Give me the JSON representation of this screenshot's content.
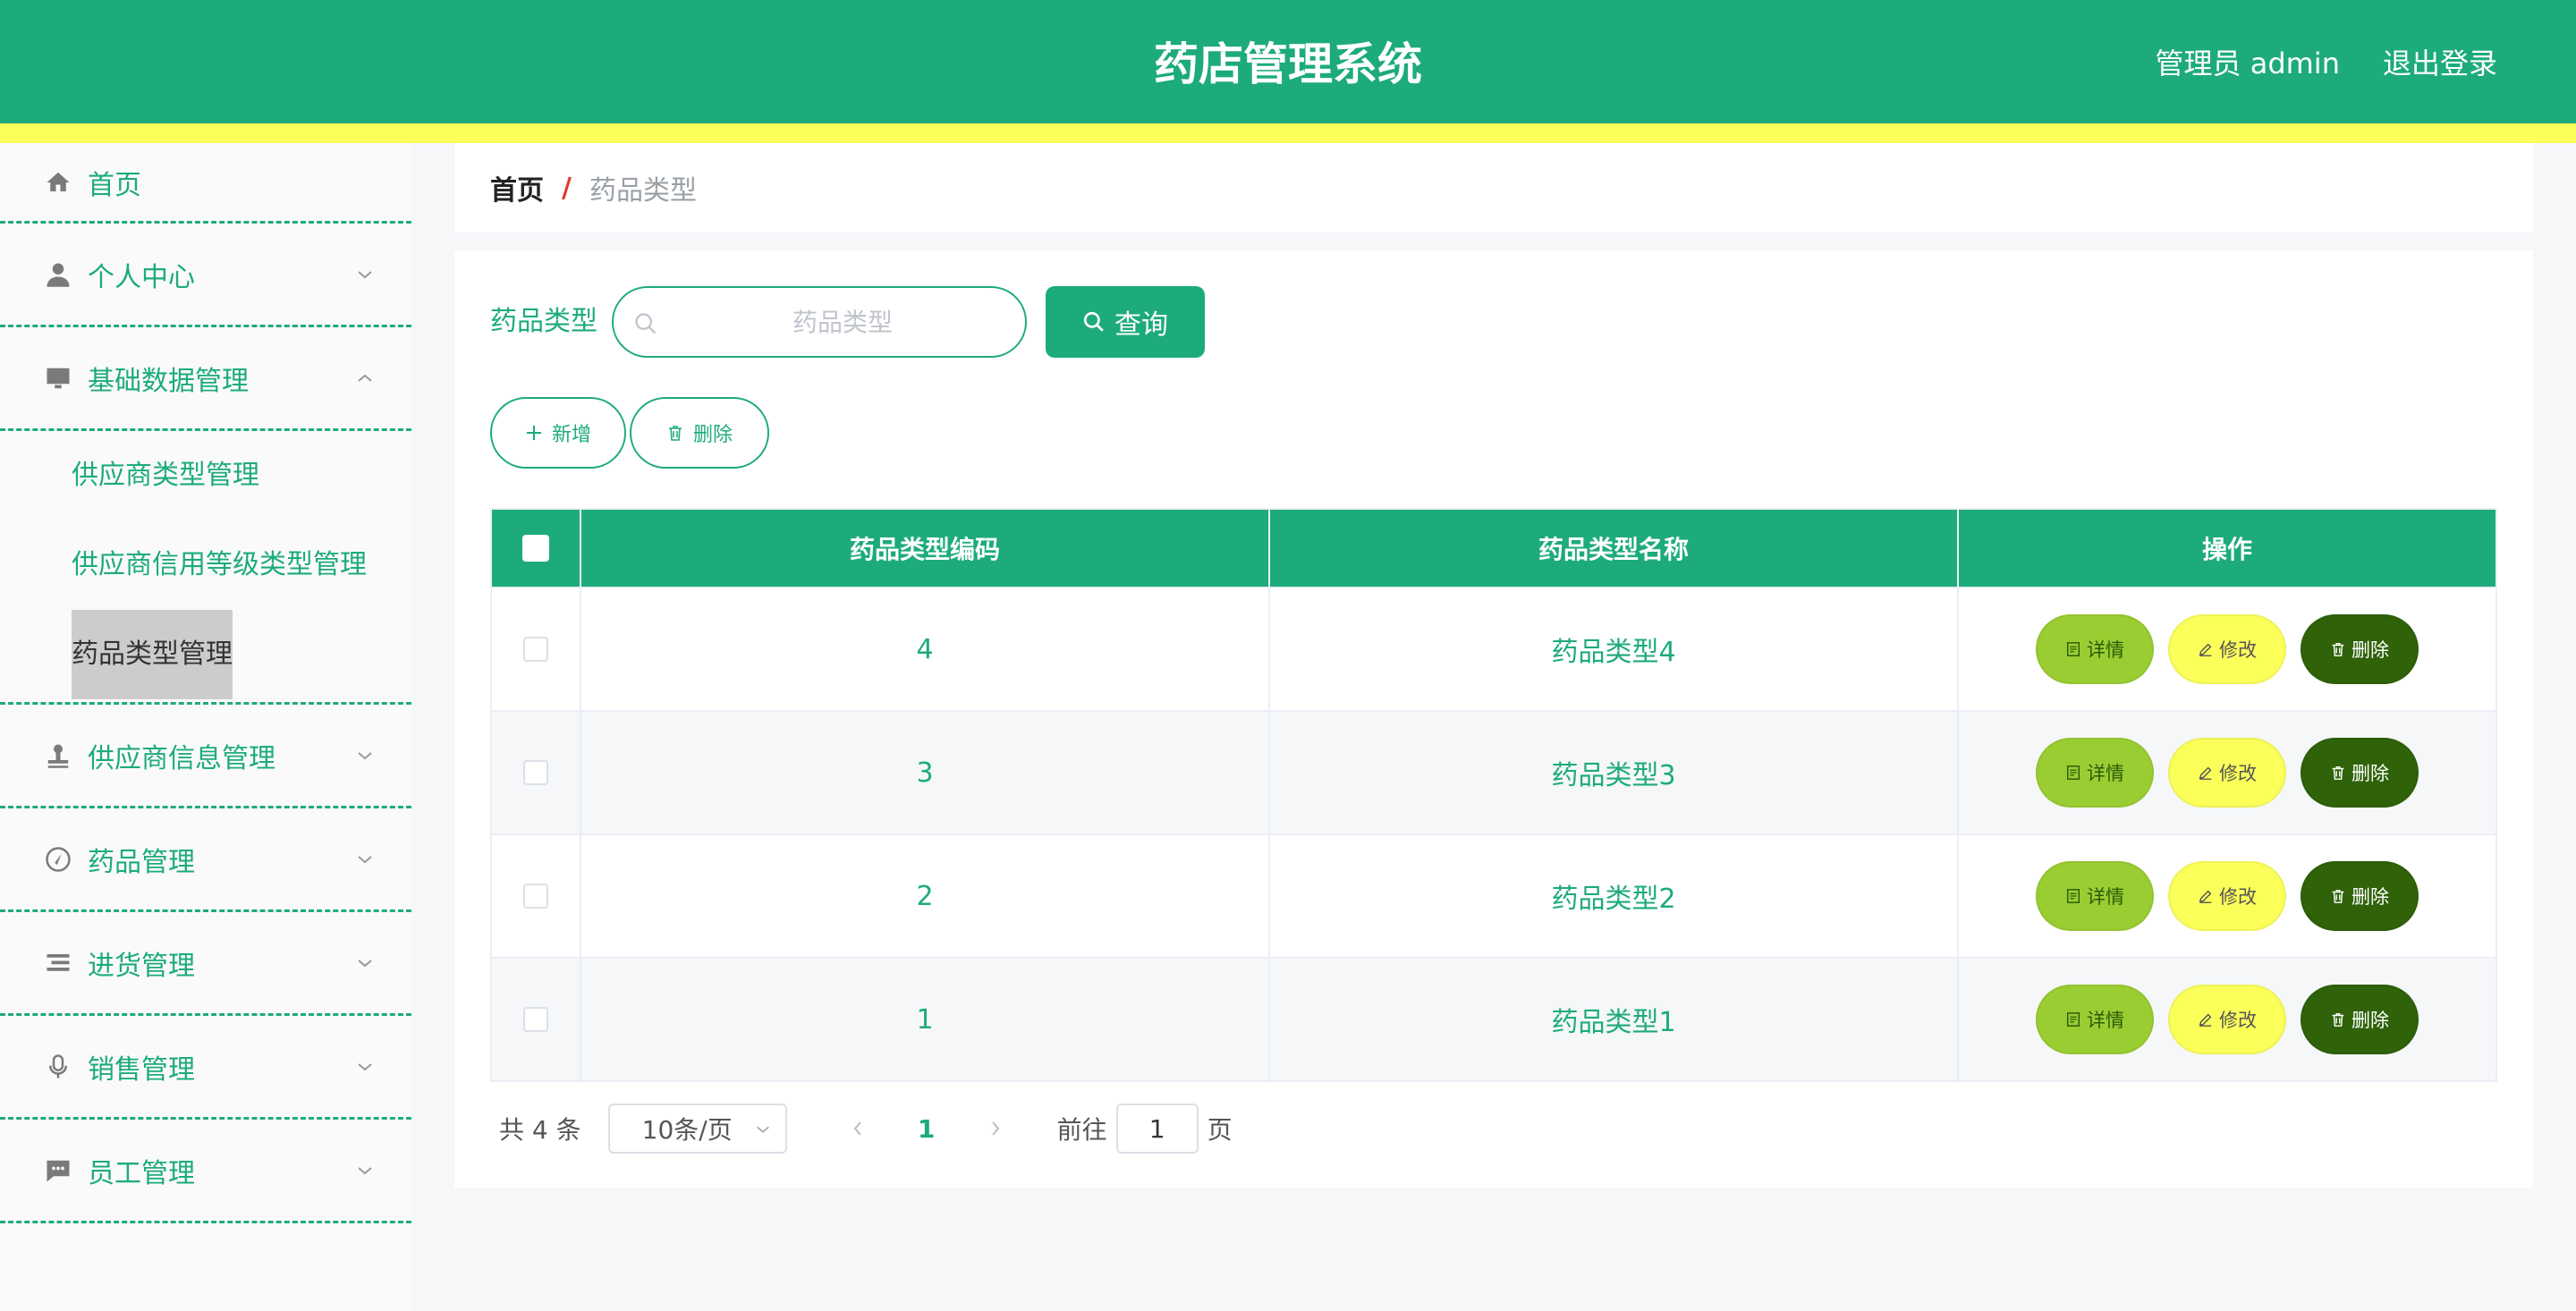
{
  "header": {
    "title": "药店管理系统",
    "user_label": "管理员 admin",
    "logout_label": "退出登录",
    "brand_color": "#1dab7b",
    "accent_strip_color": "#fbff5a"
  },
  "sidebar": {
    "items": [
      {
        "label": "首页",
        "icon": "home-icon"
      },
      {
        "label": "个人中心",
        "icon": "user-icon"
      },
      {
        "label": "基础数据管理",
        "icon": "monitor-icon",
        "expanded": true,
        "children": [
          "供应商类型管理",
          "供应商信用等级类型管理",
          "药品类型管理"
        ],
        "active_child": "药品类型管理"
      },
      {
        "label": "供应商信息管理",
        "icon": "stamp-icon"
      },
      {
        "label": "药品管理",
        "icon": "compass-icon"
      },
      {
        "label": "进货管理",
        "icon": "list-icon"
      },
      {
        "label": "销售管理",
        "icon": "microphone-icon"
      },
      {
        "label": "员工管理",
        "icon": "chat-icon"
      }
    ]
  },
  "breadcrumb": {
    "home": "首页",
    "separator": "/",
    "current": "药品类型"
  },
  "search": {
    "label": "药品类型",
    "placeholder": "药品类型",
    "value": "",
    "query_label": "查询"
  },
  "toolbar": {
    "add_label": "新增",
    "delete_label": "删除"
  },
  "table": {
    "columns": [
      "药品类型编码",
      "药品类型名称",
      "操作"
    ],
    "rows": [
      {
        "code": "4",
        "name": "药品类型4"
      },
      {
        "code": "3",
        "name": "药品类型3"
      },
      {
        "code": "2",
        "name": "药品类型2"
      },
      {
        "code": "1",
        "name": "药品类型1"
      }
    ],
    "actions": {
      "detail": "详情",
      "edit": "修改",
      "delete": "删除"
    }
  },
  "pagination": {
    "total_text": "共 4 条",
    "page_size": "10条/页",
    "current_page": "1",
    "goto_label": "前往",
    "goto_value": "1",
    "page_suffix": "页"
  }
}
